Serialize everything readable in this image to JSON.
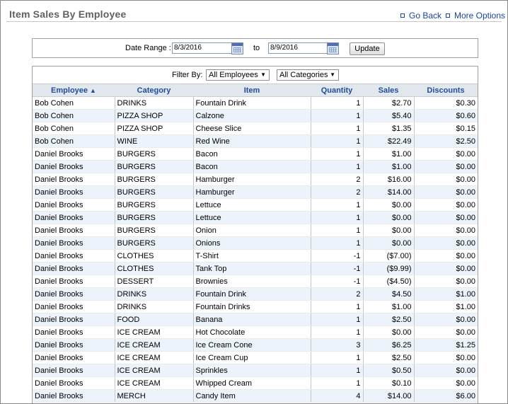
{
  "header": {
    "title": "Item Sales By Employee",
    "go_back": "Go Back",
    "more_options": "More Options"
  },
  "date_range": {
    "label": "Date Range :",
    "from": "8/3/2016",
    "to_label": "to",
    "to": "8/9/2016",
    "update_label": "Update"
  },
  "filters": {
    "label": "Filter By:",
    "employee": "All Employees",
    "category": "All Categories"
  },
  "table": {
    "columns": [
      "Employee",
      "Category",
      "Item",
      "Quantity",
      "Sales",
      "Discounts"
    ],
    "sort_indicator": "▲",
    "rows": [
      [
        "Bob Cohen",
        "DRINKS",
        "Fountain Drink",
        "1",
        "$2.70",
        "$0.30"
      ],
      [
        "Bob Cohen",
        "PIZZA SHOP",
        "Calzone",
        "1",
        "$5.40",
        "$0.60"
      ],
      [
        "Bob Cohen",
        "PIZZA SHOP",
        "Cheese Slice",
        "1",
        "$1.35",
        "$0.15"
      ],
      [
        "Bob Cohen",
        "WINE",
        "Red Wine",
        "1",
        "$22.49",
        "$2.50"
      ],
      [
        "Daniel Brooks",
        "BURGERS",
        "Bacon",
        "1",
        "$1.00",
        "$0.00"
      ],
      [
        "Daniel Brooks",
        "BURGERS",
        "Bacon",
        "1",
        "$1.00",
        "$0.00"
      ],
      [
        "Daniel Brooks",
        "BURGERS",
        "Hamburger",
        "2",
        "$16.00",
        "$0.00"
      ],
      [
        "Daniel Brooks",
        "BURGERS",
        "Hamburger",
        "2",
        "$14.00",
        "$0.00"
      ],
      [
        "Daniel Brooks",
        "BURGERS",
        "Lettuce",
        "1",
        "$0.00",
        "$0.00"
      ],
      [
        "Daniel Brooks",
        "BURGERS",
        "Lettuce",
        "1",
        "$0.00",
        "$0.00"
      ],
      [
        "Daniel Brooks",
        "BURGERS",
        "Onion",
        "1",
        "$0.00",
        "$0.00"
      ],
      [
        "Daniel Brooks",
        "BURGERS",
        "Onions",
        "1",
        "$0.00",
        "$0.00"
      ],
      [
        "Daniel Brooks",
        "CLOTHES",
        "T-Shirt",
        "-1",
        "($7.00)",
        "$0.00"
      ],
      [
        "Daniel Brooks",
        "CLOTHES",
        "Tank Top",
        "-1",
        "($9.99)",
        "$0.00"
      ],
      [
        "Daniel Brooks",
        "DESSERT",
        "Brownies",
        "-1",
        "($4.50)",
        "$0.00"
      ],
      [
        "Daniel Brooks",
        "DRINKS",
        "Fountain Drink",
        "2",
        "$4.50",
        "$1.00"
      ],
      [
        "Daniel Brooks",
        "DRINKS",
        "Fountain Drinks",
        "1",
        "$1.00",
        "$1.00"
      ],
      [
        "Daniel Brooks",
        "FOOD",
        "Banana",
        "1",
        "$2.50",
        "$0.00"
      ],
      [
        "Daniel Brooks",
        "ICE CREAM",
        "Hot Chocolate",
        "1",
        "$0.00",
        "$0.00"
      ],
      [
        "Daniel Brooks",
        "ICE CREAM",
        "Ice Cream Cone",
        "3",
        "$6.25",
        "$1.25"
      ],
      [
        "Daniel Brooks",
        "ICE CREAM",
        "Ice Cream Cup",
        "1",
        "$2.50",
        "$0.00"
      ],
      [
        "Daniel Brooks",
        "ICE CREAM",
        "Sprinkles",
        "1",
        "$0.50",
        "$0.00"
      ],
      [
        "Daniel Brooks",
        "ICE CREAM",
        "Whipped Cream",
        "1",
        "$0.10",
        "$0.00"
      ],
      [
        "Daniel Brooks",
        "MERCH",
        "Candy Item",
        "4",
        "$14.00",
        "$6.00"
      ]
    ]
  },
  "icons": {
    "calendar": "calendar-icon",
    "link_bullet": "square-bullet-icon",
    "dropdown": "chevron-down-icon"
  },
  "colors": {
    "link": "#1a44a0",
    "header_text": "#1d4e9a",
    "row_alt": "#edf3fb",
    "header_bg": "#e2e7ee"
  }
}
